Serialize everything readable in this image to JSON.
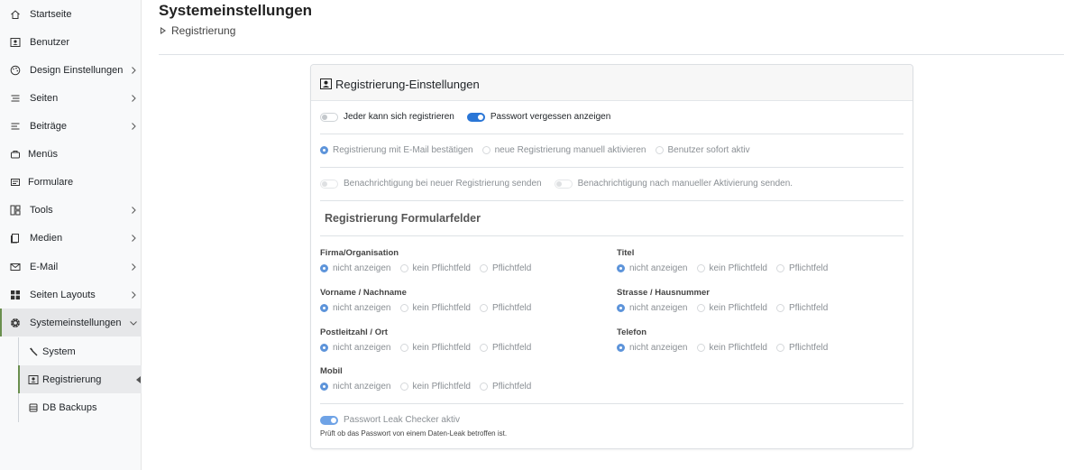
{
  "sidebar": {
    "items": [
      {
        "label": "Startseite",
        "icon": "home-icon",
        "chevron": false
      },
      {
        "label": "Benutzer",
        "icon": "user-card-icon",
        "chevron": false
      },
      {
        "label": "Design Einstellungen",
        "icon": "palette-icon",
        "chevron": true
      },
      {
        "label": "Seiten",
        "icon": "list-icon",
        "chevron": true
      },
      {
        "label": "Beiträge",
        "icon": "list-icon",
        "chevron": true
      },
      {
        "label": "Menüs",
        "icon": "menu-icon",
        "chevron": false
      },
      {
        "label": "Formulare",
        "icon": "form-icon",
        "chevron": false
      },
      {
        "label": "Tools",
        "icon": "tools-icon",
        "chevron": true
      },
      {
        "label": "Medien",
        "icon": "media-icon",
        "chevron": true
      },
      {
        "label": "E-Mail",
        "icon": "mail-icon",
        "chevron": true
      },
      {
        "label": "Seiten Layouts",
        "icon": "layout-icon",
        "chevron": true
      },
      {
        "label": "Systemeinstellungen",
        "icon": "gear-icon",
        "chevron": true,
        "expanded": true,
        "active": true
      }
    ],
    "subitems": [
      {
        "label": "System",
        "icon": "wrench-icon"
      },
      {
        "label": "Registrierung",
        "icon": "user-card-icon",
        "active": true
      },
      {
        "label": "DB Backups",
        "icon": "database-icon"
      }
    ]
  },
  "header": {
    "title": "Systemeinstellungen",
    "breadcrumb": "Registrierung"
  },
  "card": {
    "title": "Registrierung-Einstellungen",
    "toggles_row1": [
      {
        "label": "Jeder kann sich registrieren",
        "on": false
      },
      {
        "label": "Passwort vergessen anzeigen",
        "on": true
      }
    ],
    "activation_options": [
      {
        "label": "Registrierung mit E-Mail bestätigen",
        "selected": true
      },
      {
        "label": "neue Registrierung manuell aktivieren",
        "selected": false
      },
      {
        "label": "Benutzer sofort aktiv",
        "selected": false
      }
    ],
    "notifications": [
      {
        "label": "Benachrichtigung bei neuer Registrierung senden",
        "on": false
      },
      {
        "label": "Benachrichtigung nach manueller Aktivierung senden.",
        "on": false
      }
    ],
    "fields_section_title": "Registrierung Formularfelder",
    "field_options": [
      "nicht anzeigen",
      "kein Pflichtfeld",
      "Pflichtfeld"
    ],
    "fields": [
      {
        "label": "Firma/Organisation",
        "selected": "nicht anzeigen"
      },
      {
        "label": "Titel",
        "selected": "nicht anzeigen"
      },
      {
        "label": "Vorname / Nachname",
        "selected": "nicht anzeigen"
      },
      {
        "label": "Strasse / Hausnummer",
        "selected": "nicht anzeigen"
      },
      {
        "label": "Postleitzahl / Ort",
        "selected": "nicht anzeigen"
      },
      {
        "label": "Telefon",
        "selected": "nicht anzeigen"
      },
      {
        "label": "Mobil",
        "selected": "nicht anzeigen"
      }
    ],
    "leak_checker": {
      "label": "Passwort Leak Checker aktiv",
      "on": true
    },
    "leak_help": "Prüft ob das Passwort von einem Daten-Leak betroffen ist."
  },
  "colors": {
    "accent": "#2a76d6",
    "active_border": "#6a8f4e"
  }
}
